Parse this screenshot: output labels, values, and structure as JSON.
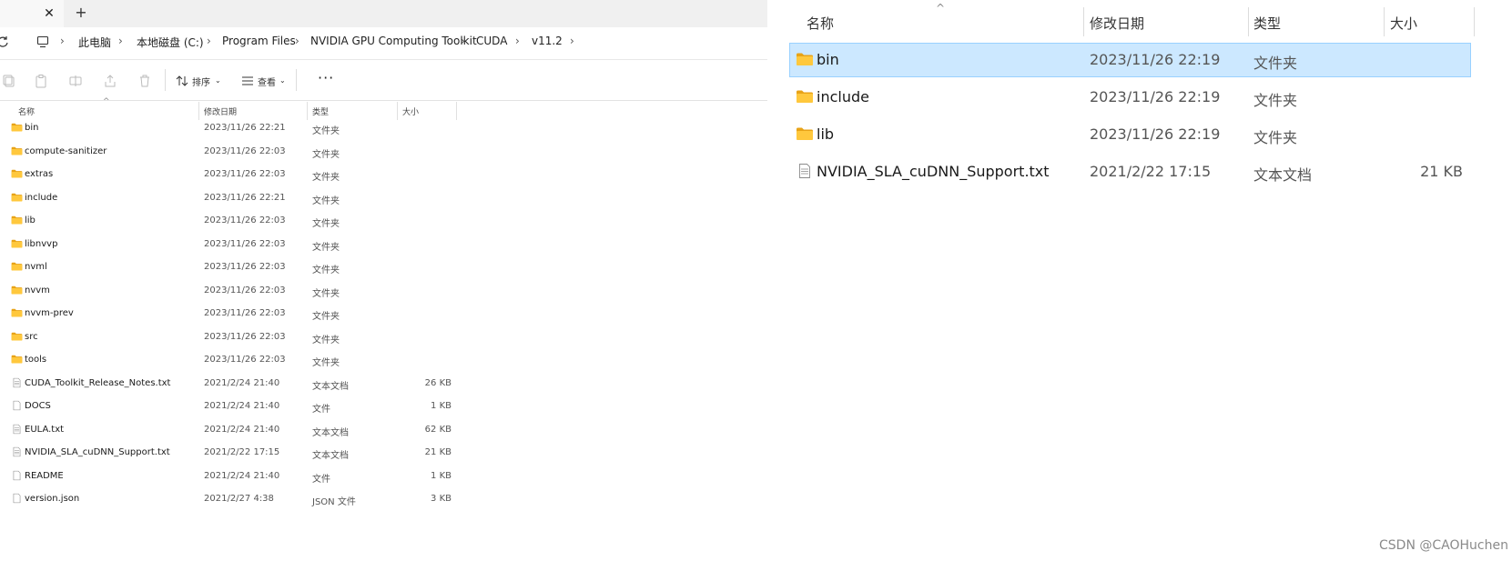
{
  "left_explorer": {
    "tab": {
      "close_glyph": "✕",
      "new_tab_glyph": "+"
    },
    "breadcrumb": [
      "此电脑",
      "本地磁盘 (C:)",
      "Program Files",
      "NVIDIA GPU Computing Toolkit",
      "CUDA",
      "v11.2"
    ],
    "toolbar": {
      "sort_label": "排序",
      "view_label": "查看",
      "more_label": "···"
    },
    "columns": {
      "name": "名称",
      "date": "修改日期",
      "type": "类型",
      "size": "大小"
    },
    "rows": [
      {
        "kind": "folder",
        "name": "bin",
        "date": "2023/11/26 22:21",
        "type": "文件夹",
        "size": ""
      },
      {
        "kind": "folder",
        "name": "compute-sanitizer",
        "date": "2023/11/26 22:03",
        "type": "文件夹",
        "size": ""
      },
      {
        "kind": "folder",
        "name": "extras",
        "date": "2023/11/26 22:03",
        "type": "文件夹",
        "size": ""
      },
      {
        "kind": "folder",
        "name": "include",
        "date": "2023/11/26 22:21",
        "type": "文件夹",
        "size": ""
      },
      {
        "kind": "folder",
        "name": "lib",
        "date": "2023/11/26 22:03",
        "type": "文件夹",
        "size": ""
      },
      {
        "kind": "folder",
        "name": "libnvvp",
        "date": "2023/11/26 22:03",
        "type": "文件夹",
        "size": ""
      },
      {
        "kind": "folder",
        "name": "nvml",
        "date": "2023/11/26 22:03",
        "type": "文件夹",
        "size": ""
      },
      {
        "kind": "folder",
        "name": "nvvm",
        "date": "2023/11/26 22:03",
        "type": "文件夹",
        "size": ""
      },
      {
        "kind": "folder",
        "name": "nvvm-prev",
        "date": "2023/11/26 22:03",
        "type": "文件夹",
        "size": ""
      },
      {
        "kind": "folder",
        "name": "src",
        "date": "2023/11/26 22:03",
        "type": "文件夹",
        "size": ""
      },
      {
        "kind": "folder",
        "name": "tools",
        "date": "2023/11/26 22:03",
        "type": "文件夹",
        "size": ""
      },
      {
        "kind": "text",
        "name": "CUDA_Toolkit_Release_Notes.txt",
        "date": "2021/2/24 21:40",
        "type": "文本文档",
        "size": "26 KB"
      },
      {
        "kind": "file",
        "name": "DOCS",
        "date": "2021/2/24 21:40",
        "type": "文件",
        "size": "1 KB"
      },
      {
        "kind": "text",
        "name": "EULA.txt",
        "date": "2021/2/24 21:40",
        "type": "文本文档",
        "size": "62 KB"
      },
      {
        "kind": "text",
        "name": "NVIDIA_SLA_cuDNN_Support.txt",
        "date": "2021/2/22 17:15",
        "type": "文本文档",
        "size": "21 KB"
      },
      {
        "kind": "file",
        "name": "README",
        "date": "2021/2/24 21:40",
        "type": "文件",
        "size": "1 KB"
      },
      {
        "kind": "file",
        "name": "version.json",
        "date": "2021/2/27 4:38",
        "type": "JSON 文件",
        "size": "3 KB"
      }
    ]
  },
  "right_explorer": {
    "columns": {
      "name": "名称",
      "date": "修改日期",
      "type": "类型",
      "size": "大小"
    },
    "rows": [
      {
        "kind": "folder",
        "name": "bin",
        "date": "2023/11/26 22:19",
        "type": "文件夹",
        "size": "",
        "selected": true
      },
      {
        "kind": "folder",
        "name": "include",
        "date": "2023/11/26 22:19",
        "type": "文件夹",
        "size": "",
        "selected": false
      },
      {
        "kind": "folder",
        "name": "lib",
        "date": "2023/11/26 22:19",
        "type": "文件夹",
        "size": "",
        "selected": false
      },
      {
        "kind": "text",
        "name": "NVIDIA_SLA_cuDNN_Support.txt",
        "date": "2021/2/22 17:15",
        "type": "文本文档",
        "size": "21 KB",
        "selected": false
      }
    ]
  },
  "watermark": "CSDN @CAOHuchen",
  "colors": {
    "folder": "#ffc83d",
    "folder_dark": "#e8a317",
    "selection": "#cce8ff",
    "selection_border": "#99d1ff"
  }
}
